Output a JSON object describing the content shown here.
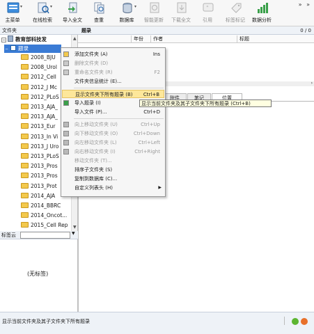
{
  "toolbar": {
    "buttons": [
      {
        "label": "主菜单",
        "icon": "main-menu-icon",
        "enabled": true,
        "dropdown": true
      },
      {
        "label": "在线检索",
        "icon": "online-search-icon",
        "enabled": true,
        "dropdown": true
      },
      {
        "label": "导入全文",
        "icon": "import-fulltext-icon",
        "enabled": true,
        "dropdown": false
      },
      {
        "label": "查重",
        "icon": "duplicate-check-icon",
        "enabled": true,
        "dropdown": false
      },
      {
        "label": "数据库",
        "icon": "database-icon",
        "enabled": true,
        "dropdown": true
      },
      {
        "label": "智能更新",
        "icon": "smart-update-icon",
        "enabled": false,
        "dropdown": false
      },
      {
        "label": "下载全文",
        "icon": "download-fulltext-icon",
        "enabled": false,
        "dropdown": false
      },
      {
        "label": "引用",
        "icon": "cite-icon",
        "enabled": false,
        "dropdown": false
      },
      {
        "label": "标签标记",
        "icon": "tag-mark-icon",
        "enabled": false,
        "dropdown": false
      },
      {
        "label": "数据分析",
        "icon": "data-analysis-icon",
        "enabled": true,
        "dropdown": false
      }
    ],
    "more": "» »"
  },
  "left_panel": {
    "header": "文件夹",
    "tree": [
      {
        "label": "教育部科技发",
        "type": "db",
        "expanded": true
      },
      {
        "label": "题录",
        "type": "root",
        "selected": true
      },
      {
        "label": "2008_BJU",
        "type": "folder"
      },
      {
        "label": "2008_Urol",
        "type": "folder"
      },
      {
        "label": "2012_Cell",
        "type": "folder"
      },
      {
        "label": "2012_J Mc",
        "type": "folder"
      },
      {
        "label": "2012_PLoS",
        "type": "folder"
      },
      {
        "label": "2013_AJA_",
        "type": "folder"
      },
      {
        "label": "2013_AJA_",
        "type": "folder"
      },
      {
        "label": "2013_Eur",
        "type": "folder"
      },
      {
        "label": "2013_In Vi",
        "type": "folder"
      },
      {
        "label": "2013_J Uro",
        "type": "folder"
      },
      {
        "label": "2013_PLoS",
        "type": "folder"
      },
      {
        "label": "2013_Pros",
        "type": "folder"
      },
      {
        "label": "2013_Pros",
        "type": "folder"
      },
      {
        "label": "2013_Prot",
        "type": "folder"
      },
      {
        "label": "2014_AJA",
        "type": "folder"
      },
      {
        "label": "2014_BBRC",
        "type": "folder"
      },
      {
        "label": "2014_Oncot...",
        "type": "folder"
      },
      {
        "label": "2015_Cell Rep",
        "type": "folder"
      }
    ]
  },
  "tag_cloud": {
    "label": "标签云",
    "empty_text": "(无标签)"
  },
  "right_panel": {
    "header": "题录",
    "count": "0 / 0",
    "columns": [
      "年份",
      "作者",
      "标题"
    ]
  },
  "bottom_tabs": [
    {
      "label": "附件",
      "active": false
    },
    {
      "label": "笔记",
      "active": false
    },
    {
      "label": "位置",
      "active": true
    }
  ],
  "context_menu": [
    {
      "label": "添加文件夹 (A)",
      "shortcut": "Ins",
      "enabled": true,
      "icon": "add-folder-icon"
    },
    {
      "label": "删除文件夹 (D)",
      "shortcut": "",
      "enabled": false,
      "icon": "delete-folder-icon"
    },
    {
      "label": "重命名文件夹 (R)",
      "shortcut": "F2",
      "enabled": false,
      "icon": "rename-folder-icon"
    },
    {
      "label": "文件夹信息统计 (E)...",
      "shortcut": "",
      "enabled": true,
      "icon": ""
    },
    {
      "sep": true
    },
    {
      "label": "显示文件夹下所有题录 (B)",
      "shortcut": "Ctrl+B",
      "enabled": true,
      "highlight": true,
      "icon": ""
    },
    {
      "label": "导入题录 (I)",
      "shortcut": "",
      "enabled": true,
      "icon": "import-records-icon"
    },
    {
      "label": "导入文件 (P)...",
      "shortcut": "Ctrl+D",
      "enabled": true,
      "icon": ""
    },
    {
      "sep": true
    },
    {
      "label": "向上移动文件夹 (U)",
      "shortcut": "Ctrl+Up",
      "enabled": false,
      "icon": "move-up-icon"
    },
    {
      "label": "向下移动文件夹 (O)",
      "shortcut": "Ctrl+Down",
      "enabled": false,
      "icon": "move-down-icon"
    },
    {
      "label": "向左移动文件夹 (L)",
      "shortcut": "Ctrl+Left",
      "enabled": false,
      "icon": "move-left-icon"
    },
    {
      "label": "向右移动文件夹 (I)",
      "shortcut": "Ctrl+Right",
      "enabled": false,
      "icon": "move-right-icon"
    },
    {
      "label": "移动文件夹 (T)...",
      "shortcut": "",
      "enabled": false,
      "icon": ""
    },
    {
      "label": "排序子文件夹 (S)",
      "shortcut": "",
      "enabled": true,
      "icon": ""
    },
    {
      "label": "复制到数据库 (C)...",
      "shortcut": "",
      "enabled": true,
      "icon": ""
    },
    {
      "label": "自定义列表头 (H)",
      "shortcut": "",
      "enabled": true,
      "submenu": true,
      "icon": ""
    }
  ],
  "tooltip": "显示当前文件夹及其子文件夹下所有题录 (Ctrl+B)",
  "status": {
    "text": "显示当前文件夹及其子文件夹下所有题录"
  },
  "colors": {
    "highlight": "#fde79a",
    "folder": "#f3c94d",
    "header_bg": "#eef2f7",
    "status_green": "#5cb531",
    "status_orange": "#e8702a"
  }
}
